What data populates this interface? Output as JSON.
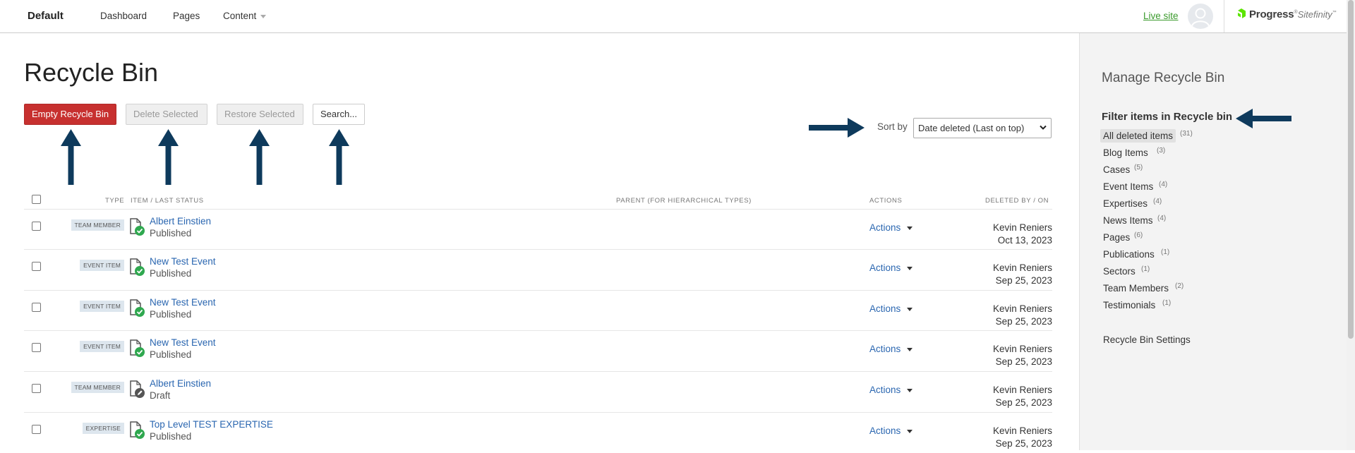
{
  "topbar": {
    "site_name": "Default",
    "nav": [
      {
        "label": "Dashboard"
      },
      {
        "label": "Pages"
      },
      {
        "label": "Content"
      }
    ],
    "live_site": "Live site",
    "brand": {
      "name": "Progress",
      "product": "Sitefinity",
      "mark_color": "#5ce500"
    },
    "avatar_icon": "user-avatar-icon"
  },
  "main": {
    "title": "Recycle Bin",
    "buttons": {
      "empty": "Empty Recycle Bin",
      "delete": "Delete Selected",
      "restore": "Restore Selected",
      "search": "Search..."
    },
    "sort": {
      "label": "Sort by",
      "value": "Date deleted (Last on top)"
    },
    "annotation_arrow_color": "#0e3a5c",
    "accent_red": "#c7302f",
    "link_color": "#2a66b0"
  },
  "table": {
    "headers": {
      "type": "TYPE",
      "item": "ITEM / LAST STATUS",
      "parent": "PARENT (FOR HIERARCHICAL TYPES)",
      "actions": "ACTIONS",
      "deleted": "DELETED BY / ON"
    },
    "rows": [
      {
        "type": "TEAM MEMBER",
        "title": "Albert Einstien",
        "status": "Published",
        "status_icon": "published-check-icon",
        "actions": "Actions",
        "by": "Kevin Reniers",
        "on": "Oct 13, 2023"
      },
      {
        "type": "EVENT ITEM",
        "title": "New Test Event",
        "status": "Published",
        "status_icon": "published-check-icon",
        "actions": "Actions",
        "by": "Kevin Reniers",
        "on": "Sep 25, 2023"
      },
      {
        "type": "EVENT ITEM",
        "title": "New Test Event",
        "status": "Published",
        "status_icon": "published-check-icon",
        "actions": "Actions",
        "by": "Kevin Reniers",
        "on": "Sep 25, 2023"
      },
      {
        "type": "EVENT ITEM",
        "title": "New Test Event",
        "status": "Published",
        "status_icon": "published-check-icon",
        "actions": "Actions",
        "by": "Kevin Reniers",
        "on": "Sep 25, 2023"
      },
      {
        "type": "TEAM MEMBER",
        "title": "Albert Einstien",
        "status": "Draft",
        "status_icon": "draft-pencil-icon",
        "actions": "Actions",
        "by": "Kevin Reniers",
        "on": "Sep 25, 2023"
      },
      {
        "type": "EXPERTISE",
        "title": "Top Level TEST EXPERTISE",
        "status": "Published",
        "status_icon": "published-check-icon",
        "actions": "Actions",
        "by": "Kevin Reniers",
        "on": "Sep 25, 2023"
      }
    ]
  },
  "panel": {
    "title": "Manage Recycle Bin",
    "filter_title": "Filter items in Recycle bin",
    "filters": [
      {
        "label": "All deleted items",
        "count": "(31)",
        "selected": true
      },
      {
        "label": "Blog Items",
        "count": "(3)"
      },
      {
        "label": "Cases",
        "count": "(5)"
      },
      {
        "label": "Event Items",
        "count": "(4)"
      },
      {
        "label": "Expertises",
        "count": "(4)"
      },
      {
        "label": "News Items",
        "count": "(4)"
      },
      {
        "label": "Pages",
        "count": "(6)"
      },
      {
        "label": "Publications",
        "count": "(1)"
      },
      {
        "label": "Sectors",
        "count": "(1)"
      },
      {
        "label": "Team Members",
        "count": "(2)"
      },
      {
        "label": "Testimonials",
        "count": "(1)"
      }
    ],
    "settings_link": "Recycle Bin Settings"
  }
}
